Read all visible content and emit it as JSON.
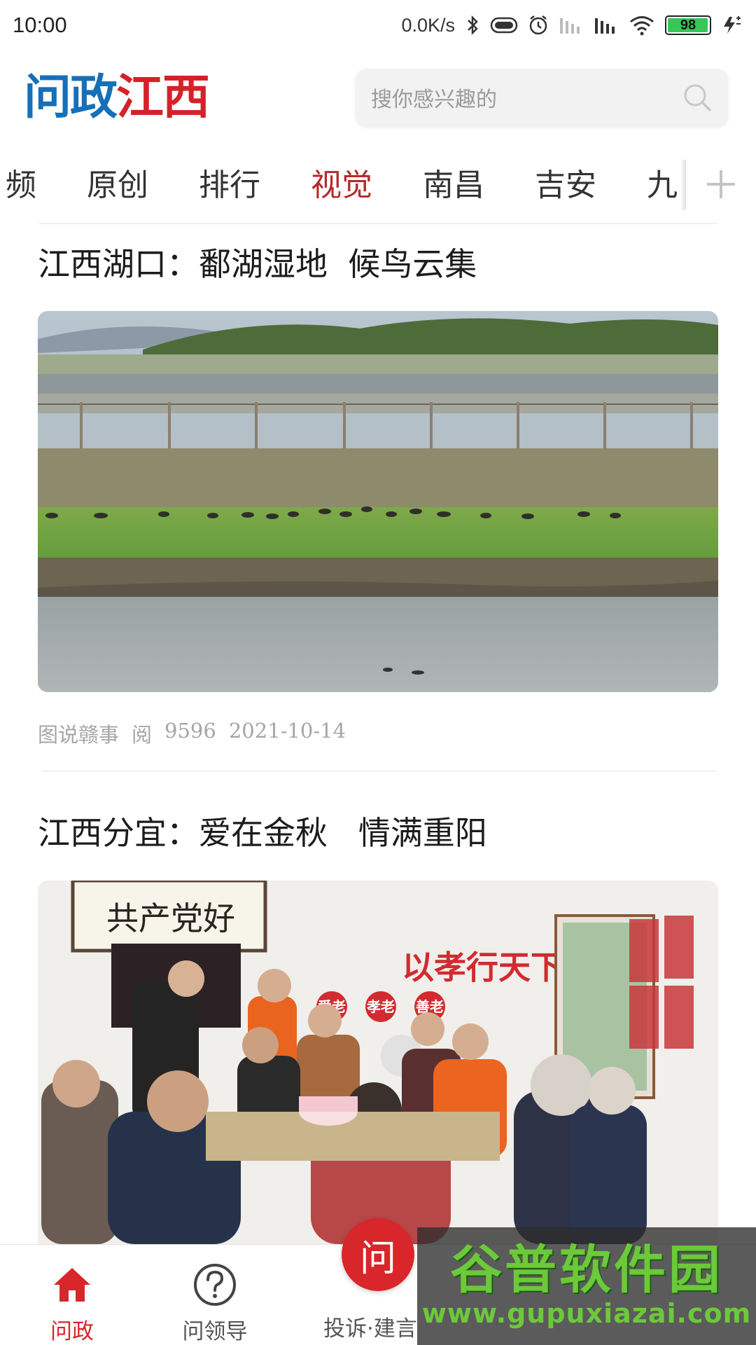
{
  "status_bar": {
    "time": "10:00",
    "network_speed": "0.0K/s",
    "battery_level": "98",
    "battery_percent": 98,
    "icons": [
      "bluetooth-icon",
      "toggle-icon",
      "alarm-icon",
      "signal-icon",
      "signal-icon",
      "wifi-icon",
      "battery-icon",
      "charging-icon"
    ]
  },
  "header": {
    "logo_part1": "问政",
    "logo_part2": "江西",
    "search_placeholder": "搜你感兴趣的",
    "colors": {
      "logo_blue": "#1670b8",
      "logo_red": "#d4222a"
    }
  },
  "channels": {
    "items": [
      "频",
      "原创",
      "排行",
      "视觉",
      "南昌",
      "吉安",
      "九"
    ],
    "active": "视觉",
    "add_icon": "plus-icon",
    "active_color": "#b8292d"
  },
  "feed": {
    "articles": [
      {
        "title": "江西湖口：鄱湖湿地  候鸟云集",
        "image_desc": "wetland-with-birds-photo",
        "source": "图说赣事",
        "read_label": "阅",
        "reads": "9596",
        "date": "2021-10-14"
      },
      {
        "title": "江西分宜：爱在金秋   情满重阳",
        "image_desc": "elderly-birthday-gathering-photo",
        "banner_text": "以孝行天下",
        "banner_hearts": [
          "爱老",
          "孝老",
          "善老"
        ],
        "calligraphy": "共产党好"
      }
    ]
  },
  "bottom_nav": {
    "items": [
      {
        "label": "问政",
        "icon": "home-icon",
        "active": true
      },
      {
        "label": "问领导",
        "icon": "question-icon",
        "active": false
      },
      {
        "label": "投诉·建言",
        "icon": "ask-center-icon",
        "center_char": "问",
        "active": false
      }
    ],
    "active_color": "#d8262a"
  },
  "watermark": {
    "main": "谷普软件园",
    "sub": "www.gupuxiazai.com"
  }
}
